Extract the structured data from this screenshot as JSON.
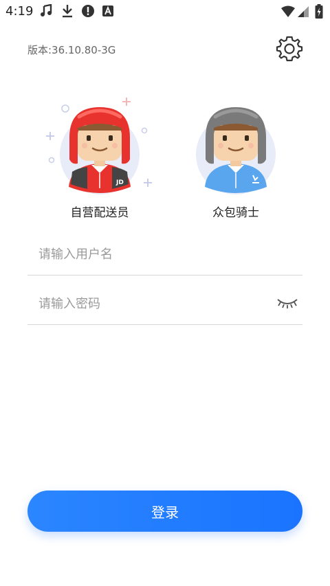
{
  "status_bar": {
    "time": "4:19",
    "icons": [
      "music-note-icon",
      "download-icon",
      "alert-icon",
      "a-icon",
      "wifi-icon",
      "signal-icon",
      "battery-charging-icon"
    ]
  },
  "header": {
    "version": "版本:36.10.80-3G",
    "settings_icon": "gear-icon"
  },
  "roles": [
    {
      "label": "自营配送员",
      "helmet_color": "#e8322d",
      "badge": "JD"
    },
    {
      "label": "众包骑士",
      "helmet_color": "#7a7a7a",
      "badge": ""
    }
  ],
  "form": {
    "username_placeholder": "请输入用户名",
    "password_placeholder": "请输入密码",
    "eye_icon": "eye-closed-icon"
  },
  "actions": {
    "login_label": "登录"
  },
  "colors": {
    "accent": "#1a74ff",
    "jd_red": "#e8322d"
  }
}
